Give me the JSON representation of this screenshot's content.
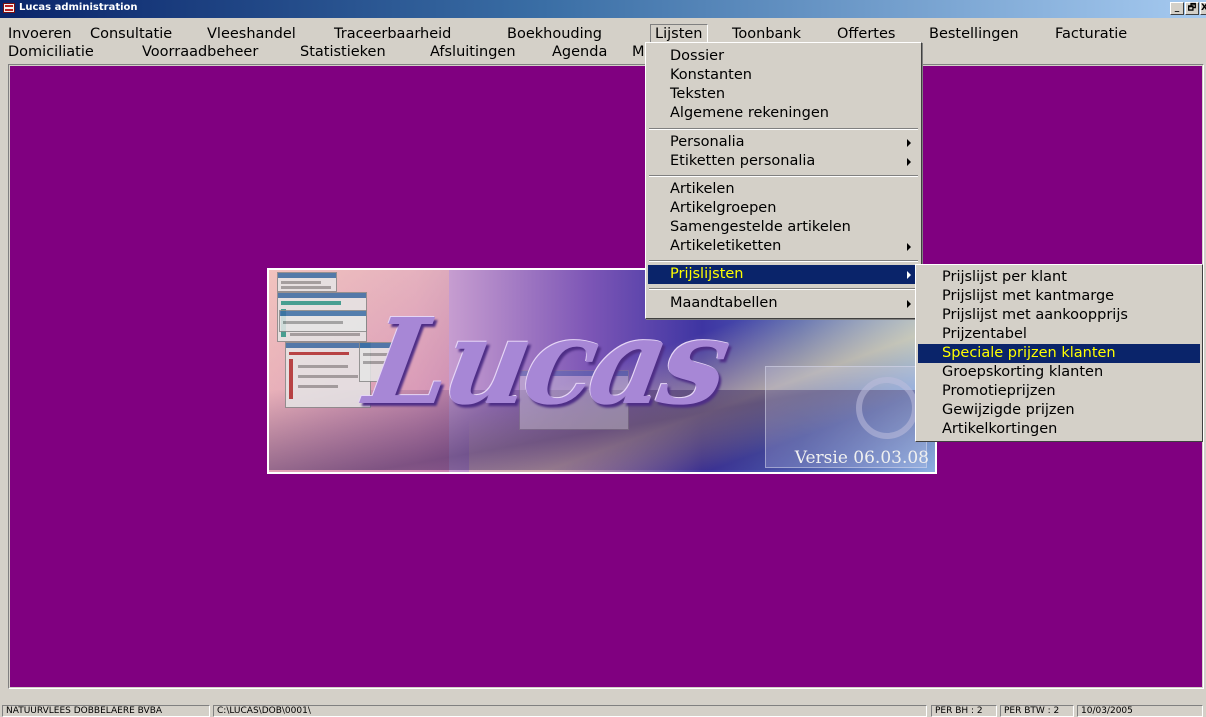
{
  "window": {
    "title": "Lucas administration",
    "controls": {
      "minimize": "_",
      "restore": "🗗",
      "close": "X"
    }
  },
  "menubar": {
    "row1": [
      "Invoeren",
      "Consultatie",
      "Vleeshandel",
      "Traceerbaarheid",
      "Boekhouding",
      "Lijsten",
      "Toonbank",
      "Offertes",
      "Bestellingen",
      "Facturatie"
    ],
    "row2": [
      "Domiciliatie",
      "Voorraadbeheer",
      "Statistieken",
      "Afsluitingen",
      "Agenda",
      "M"
    ],
    "active": "Lijsten"
  },
  "lijsten_menu": {
    "items": [
      "Dossier",
      "Konstanten",
      "Teksten",
      "Algemene rekeningen",
      "Personalia",
      "Etiketten personalia",
      "Artikelen",
      "Artikelgroepen",
      "Samengestelde artikelen",
      "Artikeletiketten",
      "Prijslijsten",
      "Maandtabellen"
    ],
    "highlighted": "Prijslijsten"
  },
  "prijslijsten_menu": {
    "items": [
      "Prijslijst per klant",
      "Prijslijst met kantmarge",
      "Prijslijst met aankoopprijs",
      "Prijzentabel",
      "Speciale prijzen klanten",
      "Groepskorting klanten",
      "Promotieprijzen",
      "Gewijzigde prijzen",
      "Artikelkortingen"
    ],
    "highlighted": "Speciale prijzen klanten"
  },
  "splash": {
    "logo_text": "Lucas",
    "version": "Versie 06.03.08"
  },
  "statusbar": {
    "company": "NATUURVLEES DOBBELAERE BVBA",
    "path": "C:\\LUCAS\\DOB\\0001\\",
    "per_bh": "PER BH :   2",
    "per_btw": "PER BTW :   2",
    "date": "10/03/2005"
  },
  "colors": {
    "workspace": "#800080",
    "menu_highlight": "#0a246a",
    "highlight_text": "#ffff00",
    "titlebar": "#0a246a"
  }
}
